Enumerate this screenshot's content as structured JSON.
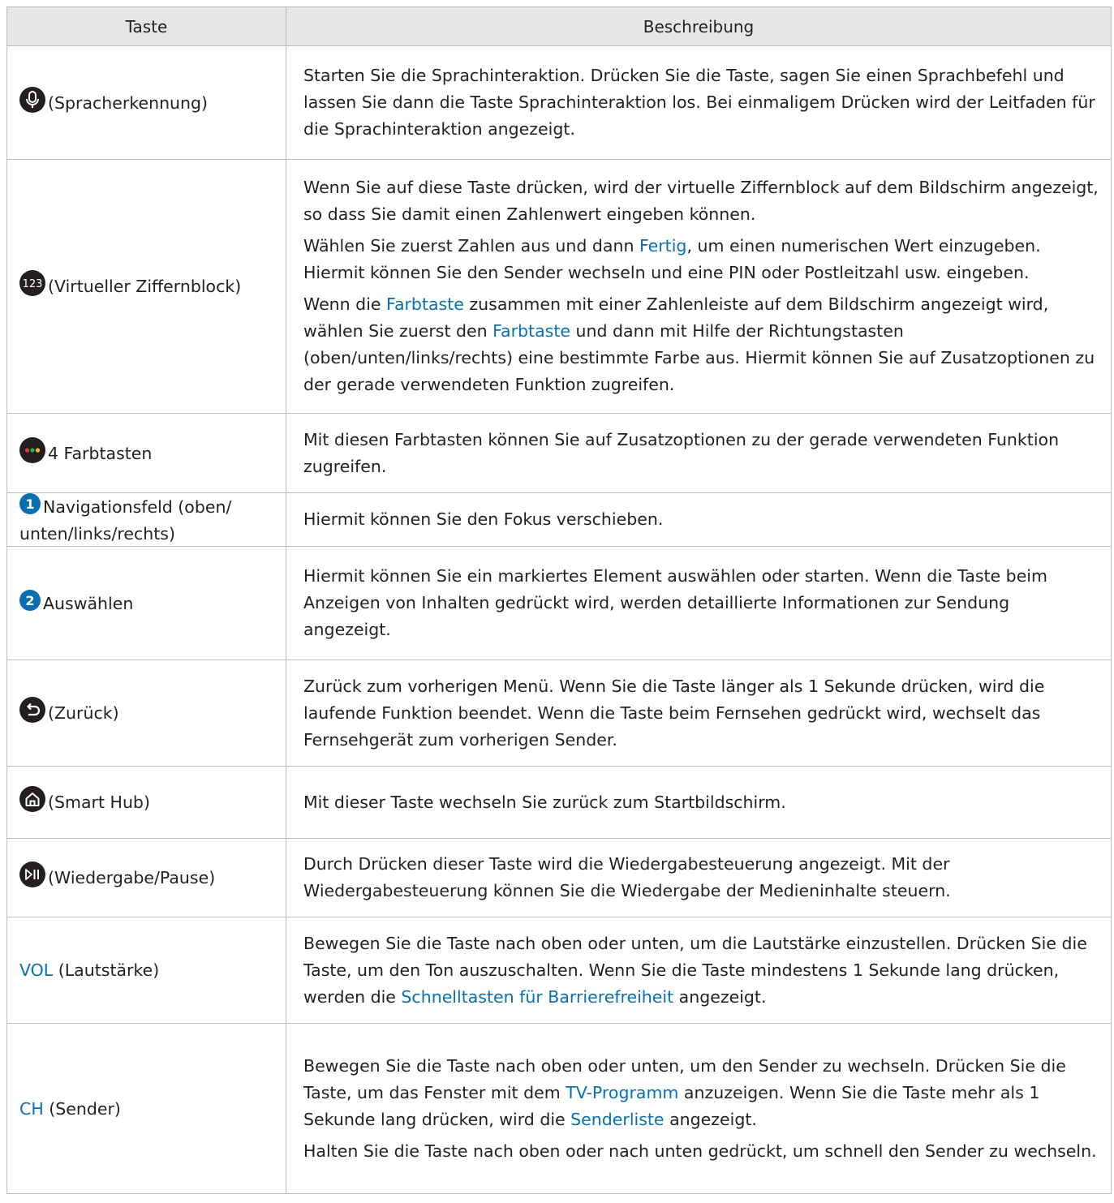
{
  "header": {
    "col_key": "Taste",
    "col_desc": "Beschreibung"
  },
  "rows": [
    {
      "icon": "microphone-icon",
      "key_label": "(Spracherkennung)",
      "p": [
        "Starten Sie die Sprachinteraktion. Drücken Sie die Taste, sagen Sie einen Sprachbefehl und lassen Sie dann die Taste Sprachinteraktion los. Bei einmaligem Drücken wird der Leitfaden für die Sprachinteraktion angezeigt."
      ]
    },
    {
      "icon": "number-pad-icon",
      "icon_text": "123",
      "key_label": "(Virtueller Ziffernblock)",
      "p1": "Wenn Sie auf diese Taste drücken, wird der virtuelle Ziffernblock auf dem Bildschirm angezeigt, so dass Sie damit einen Zahlenwert eingeben können.",
      "p2": {
        "a": "Wählen Sie zuerst Zahlen aus und dann ",
        "link": "Fertig",
        "b": ", um einen numerischen Wert einzugeben. Hiermit können Sie den Sender wechseln und eine PIN oder Postleitzahl usw. eingeben."
      },
      "p3": {
        "a": "Wenn die ",
        "link1": "Farbtaste",
        "b": " zusammen mit einer Zahlenleiste auf dem Bildschirm angezeigt wird, wählen Sie zuerst den ",
        "link2": "Farbtaste",
        "c": " und dann mit Hilfe der Richtungstasten (oben/unten/links/rechts) eine bestimmte Farbe aus. Hiermit können Sie auf Zusatzoptionen zu der gerade verwendeten Funktion zugreifen."
      }
    },
    {
      "icon": "color-keys-icon",
      "key_label": "4 Farbtasten",
      "p": [
        "Mit diesen Farbtasten können Sie auf Zusatzoptionen zu der gerade verwendeten Funktion zugreifen."
      ]
    },
    {
      "icon": "number-one-icon",
      "icon_text": "1",
      "key_label": "Navigationsfeld (oben/ unten/links/rechts)",
      "p": [
        "Hiermit können Sie den Fokus verschieben."
      ]
    },
    {
      "icon": "number-two-icon",
      "icon_text": "2",
      "key_label": "Auswählen",
      "p": [
        "Hiermit können Sie ein markiertes Element auswählen oder starten. Wenn die Taste beim Anzeigen von Inhalten gedrückt wird, werden detaillierte Informationen zur Sendung angezeigt."
      ]
    },
    {
      "icon": "return-icon",
      "key_label": "(Zurück)",
      "p": [
        "Zurück zum vorherigen Menü. Wenn Sie die Taste länger als 1 Sekunde drücken, wird die laufende Funktion beendet. Wenn die Taste beim Fernsehen gedrückt wird, wechselt das Fernsehgerät zum vorherigen Sender."
      ]
    },
    {
      "icon": "home-icon",
      "key_label": "(Smart Hub)",
      "p": [
        "Mit dieser Taste wechseln Sie zurück zum Startbildschirm."
      ]
    },
    {
      "icon": "play-pause-icon",
      "key_label": "(Wiedergabe/Pause)",
      "p": [
        "Durch Drücken dieser Taste wird die Wiedergabesteuerung angezeigt. Mit der Wiedergabesteuerung können Sie die Wiedergabe der Medieninhalte steuern."
      ]
    },
    {
      "key_hl": "VOL",
      "key_label": " (Lautstärke)",
      "p1": {
        "a": "Bewegen Sie die Taste nach oben oder unten, um die Lautstärke einzustellen. Drücken Sie die Taste, um den Ton auszuschalten. Wenn Sie die Taste mindestens 1 Sekunde lang drücken, werden die ",
        "link": "Schnelltasten für Barrierefreiheit",
        "b": " angezeigt."
      }
    },
    {
      "key_hl": "CH",
      "key_label": " (Sender)",
      "p1": {
        "a": "Bewegen Sie die Taste nach oben oder unten, um den Sender zu wechseln. Drücken Sie die Taste, um das Fenster mit dem ",
        "link1": "TV-Programm",
        "b": " anzuzeigen. Wenn Sie die Taste mehr als 1 Sekunde lang drücken, wird die ",
        "link2": "Senderliste",
        "c": " angezeigt."
      },
      "p2": "Halten Sie die Taste nach oben oder nach unten gedrückt, um schnell den Sender zu wechseln."
    }
  ],
  "colors": {
    "link": "#0a6fb0",
    "header_bg": "#e6e6e6",
    "border": "#bdbdbd",
    "icon": "#231f20",
    "badge": "#0a6fb0"
  }
}
